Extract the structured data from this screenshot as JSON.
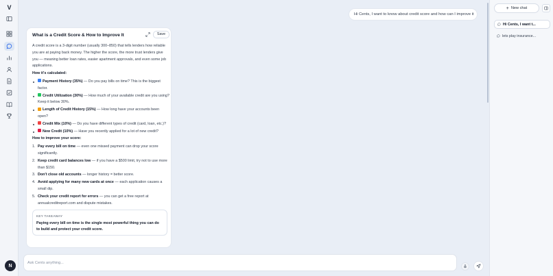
{
  "rail": {
    "logo": "V",
    "avatar": "N"
  },
  "conversation": {
    "user_message": "Hi Cents, I want to know about credit score and how can I improve it"
  },
  "card": {
    "title": "What is a Credit Score & How to Improve It",
    "save_label": "Save",
    "intro": "A credit score is a 3-digit number (usually 300–850) that tells lenders how reliable you are at paying back money. The higher the score, the more trust lenders give you — meaning better loan rates, easier apartment approvals, and even some job applications.",
    "calc_heading": "How it's calculated:",
    "factors": [
      {
        "color": "#3b82f6",
        "label": "Payment History (35%)",
        "text": " — Do you pay bills on time? This is the biggest factor."
      },
      {
        "color": "#22c55e",
        "label": "Credit Utilization (30%)",
        "text": " — How much of your available credit are you using? Keep it below 30%."
      },
      {
        "color": "#f59e0b",
        "label": "Length of Credit History (15%)",
        "text": " — How long have your accounts been open?"
      },
      {
        "color": "#ef4444",
        "label": "Credit Mix (10%)",
        "text": " — Do you have different types of credit (card, loan, etc.)?"
      },
      {
        "color": "#e11d48",
        "label": "New Credit (10%)",
        "text": " — Have you recently applied for a lot of new credit?"
      }
    ],
    "improve_heading": "How to improve your score:",
    "tips": [
      {
        "num": "1.",
        "label": "Pay every bill on time",
        "text": " — even one missed payment can drop your score significantly."
      },
      {
        "num": "2.",
        "label": "Keep credit card balances low",
        "text": " — if you have a $500 limit, try not to use more than $150."
      },
      {
        "num": "3.",
        "label": "Don't close old accounts",
        "text": " — longer history = better score."
      },
      {
        "num": "4.",
        "label": "Avoid applying for many new cards at once",
        "text": " — each application causes a small dip."
      },
      {
        "num": "5.",
        "label": "Check your credit report for errors",
        "text": " — you can get a free report at annualcreditreport.com and dispute mistakes."
      }
    ],
    "takeaway_label": "KEY TAKEAWAY",
    "takeaway_text": "Paying every bill on time is the single most powerful thing you can do to build and protect your credit score."
  },
  "composer": {
    "placeholder": "Ask Cents anything..."
  },
  "right_panel": {
    "new_chat_label": "New chat",
    "chats": [
      {
        "label": "Hi Cents, I want t...",
        "active": true
      },
      {
        "label": "lets play insurance...",
        "active": false
      }
    ]
  }
}
